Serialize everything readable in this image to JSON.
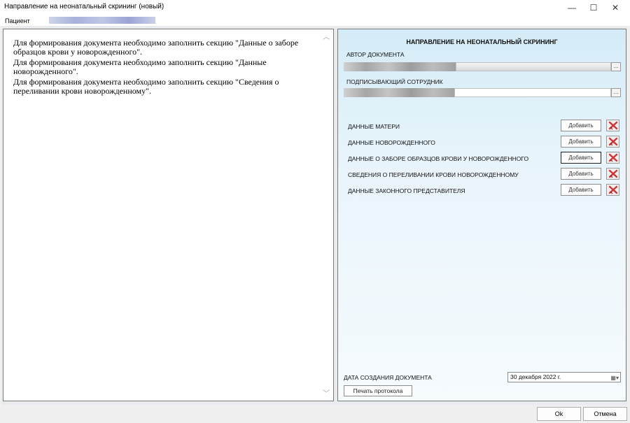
{
  "window": {
    "title": "Направление на неонатальный скрининг (новый)",
    "minimize_icon": "minimize-icon",
    "maximize_icon": "maximize-icon",
    "close_icon": "close-icon"
  },
  "patient": {
    "label": "Пациент"
  },
  "messages": [
    "Для формирования документа необходимо заполнить секцию \"Данные о заборе образцов крови у новорожденного\".",
    "Для формирования документа необходимо заполнить секцию \"Данные новорожденного\".",
    "Для формирования документа необходимо заполнить секцию \"Сведения о переливании крови новорожденному\"."
  ],
  "form": {
    "title": "НАПРАВЛЕНИЕ НА НЕОНАТАЛЬНЫЙ СКРИНИНГ",
    "author_label": "АВТОР ДОКУМЕНТА",
    "signer_label": "ПОДПИСЫВАЮЩИЙ СОТРУДНИК",
    "ellipsis": "...",
    "sections": [
      {
        "label": "ДАННЫЕ МАТЕРИ",
        "add_label": "Добавить"
      },
      {
        "label": "ДАННЫЕ НОВОРОЖДЕННОГО",
        "add_label": "Добавить"
      },
      {
        "label": "ДАННЫЕ О ЗАБОРЕ ОБРАЗЦОВ КРОВИ У НОВОРОЖДЕННОГО",
        "add_label": "Добавить"
      },
      {
        "label": "СВЕДЕНИЯ О ПЕРЕЛИВАНИИ КРОВИ НОВОРОЖДЕННОМУ",
        "add_label": "Добавить"
      },
      {
        "label": "ДАННЫЕ ЗАКОННОГО ПРЕДСТАВИТЕЛЯ",
        "add_label": "Добавить"
      }
    ],
    "date_label": "ДАТА СОЗДАНИЯ ДОКУМЕНТА",
    "date_value": "30 декабря  2022 г.",
    "print_label": "Печать протокола"
  },
  "footer": {
    "ok_label": "Ok",
    "cancel_label": "Отмена"
  }
}
